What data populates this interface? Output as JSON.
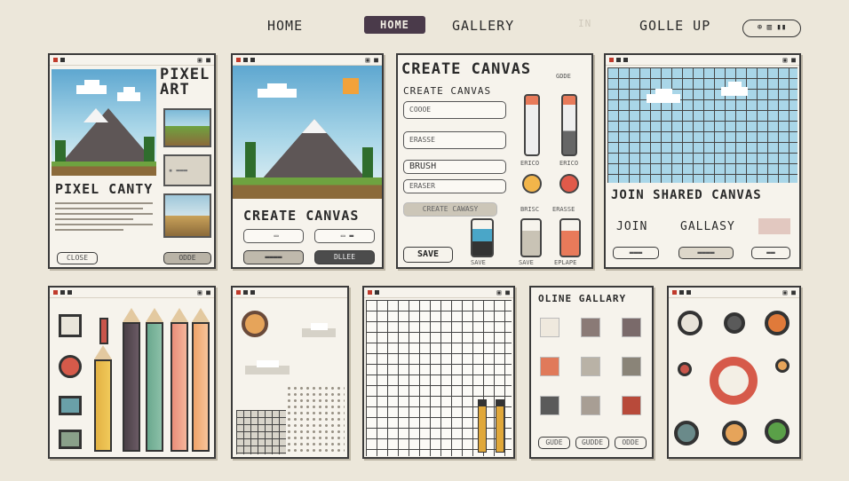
{
  "nav": {
    "home": "HOME",
    "home_active": "HOME",
    "gallery": "GALLERY",
    "faded_link": "IN",
    "signup": "GOLLE UP",
    "pill": "⊕ ▥ ▮▮"
  },
  "colors": {
    "background": "#ece7da",
    "accent": "#4a3a4a",
    "sky": "#5ea7d0",
    "grass": "#6ea340",
    "red": "#c03a2b"
  },
  "window_controls": "▣ ■",
  "panel1": {
    "title": "PIXEL ART",
    "subtitle": "PIXEL CANTY",
    "button": "CLOSE",
    "button_right": "ODDE",
    "label_mid": "▪ ▬▬▬"
  },
  "panel2": {
    "title": "CREATE CANVAS",
    "field1": "▭",
    "field2": "▭ ▬",
    "btn_left": "▬▬▬▬",
    "btn_right": "DLLEE"
  },
  "panel3": {
    "heading": "CREATE CANVAS",
    "subheading": "CREATE CANVAS",
    "field_color": "COOOE",
    "field_eraser": "ERASSE",
    "field_brush": "BRUSH",
    "field_eraser2": "ERASER",
    "create_button": "CREATE CAWASY",
    "save_button": "SAVE",
    "tool_labels": [
      "ERICO",
      "ERICO",
      "BRISC",
      "ERASSE",
      "SAVE",
      "SAVE",
      "EPLAPE"
    ],
    "top_label": "GDDE"
  },
  "panel4": {
    "title": "JOIN SHARED CANVAS",
    "join_label": "JOIN",
    "gallery_label": "GALLASY",
    "buttons": [
      "▬▬▬",
      "▬▬▬▬",
      "▬▬"
    ]
  },
  "panel8": {
    "title": "OLINE GALLARY",
    "buttons": [
      "GUDE",
      "GUDDE",
      "ODDE"
    ]
  }
}
